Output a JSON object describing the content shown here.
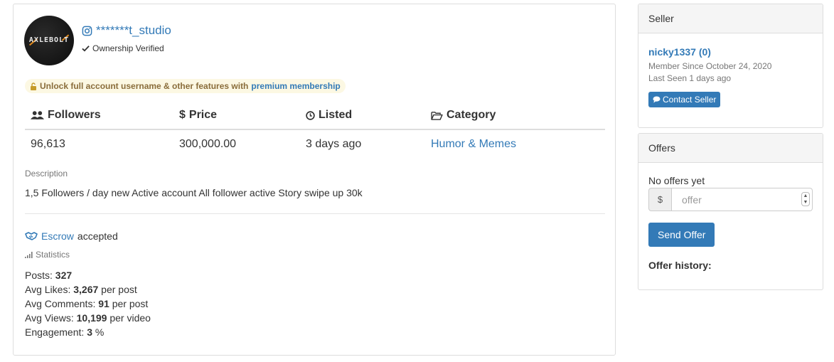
{
  "listing": {
    "avatar_logo": "AXLEBOLT",
    "handle": "*******t_studio",
    "ownership": "Ownership Verified",
    "premium_prefix": "Unlock full account username & other features with",
    "premium_link": "premium membership",
    "table": {
      "headers": [
        "Followers",
        "Price",
        "Listed",
        "Category"
      ],
      "values": [
        "96,613",
        "300,000.00",
        "3 days ago",
        "Humor & Memes"
      ]
    },
    "description_label": "Description",
    "description": "1,5 Followers / day new Active account All follower active Story swipe up 30k",
    "escrow_link": "Escrow",
    "escrow_suffix": "accepted",
    "statistics_label": "Statistics",
    "stats": [
      {
        "label": "Posts:",
        "value": "327",
        "suffix": ""
      },
      {
        "label": "Avg Likes:",
        "value": "3,267",
        "suffix": "per post"
      },
      {
        "label": "Avg Comments:",
        "value": "91",
        "suffix": "per post"
      },
      {
        "label": "Avg Views:",
        "value": "10,199",
        "suffix": "per video"
      },
      {
        "label": "Engagement:",
        "value": "3",
        "suffix": "%"
      }
    ]
  },
  "seller": {
    "heading": "Seller",
    "name": "nicky1337 (0)",
    "member_since": "Member Since October 24, 2020",
    "last_seen": "Last Seen 1 days ago",
    "contact_label": "Contact Seller"
  },
  "offers": {
    "heading": "Offers",
    "no_offers": "No offers yet",
    "currency": "$",
    "placeholder": "offer",
    "send_label": "Send Offer",
    "history_label": "Offer history:"
  },
  "colors": {
    "link": "#337ab7",
    "premium_bg": "#fcf8e3",
    "premium_text": "#8a6d3b",
    "button": "#337ab7"
  },
  "icons": [
    "instagram-icon",
    "check-icon",
    "unlock-icon",
    "users-icon",
    "dollar-icon",
    "clock-icon",
    "folder-open-icon",
    "handshake-icon",
    "bar-chart-icon",
    "comment-icon"
  ]
}
